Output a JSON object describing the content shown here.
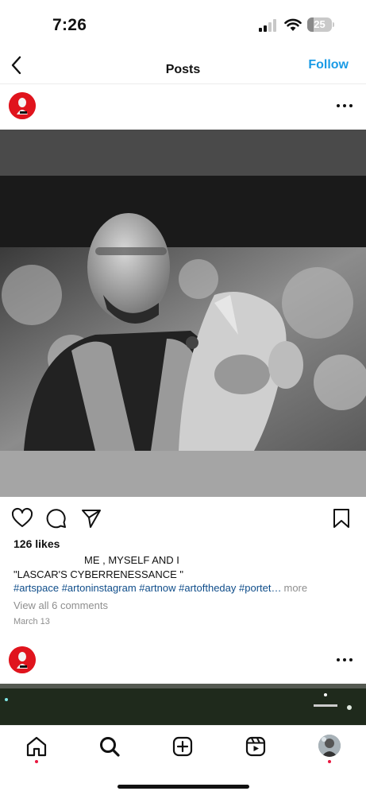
{
  "status_bar": {
    "time": "7:26",
    "battery": "25",
    "battery_level_percent": 25
  },
  "header": {
    "title": "Posts",
    "follow_label": "Follow",
    "back_icon": "chevron-left-icon"
  },
  "post": {
    "likes": "126 likes",
    "caption_line1": "ME , MYSELF AND I",
    "caption_line2": "\"LASCAR'S CYBERRENESSANCE \"",
    "hashtags": "#artspace #artoninstagram #artnow #artoftheday #portet…",
    "more_label": "more",
    "comments_link": "View all 6 comments",
    "date": "March 13",
    "actions": [
      "heart-icon",
      "comment-icon",
      "share-icon",
      "bookmark-icon"
    ]
  },
  "tabs": [
    "home-icon",
    "search-icon",
    "create-icon",
    "reels-icon",
    "profile-avatar"
  ],
  "colors": {
    "accent": "#1a9be6",
    "hashtag": "#0f4d8a",
    "avatar_red": "#e0141d",
    "notification_dot": "#e8173f"
  }
}
